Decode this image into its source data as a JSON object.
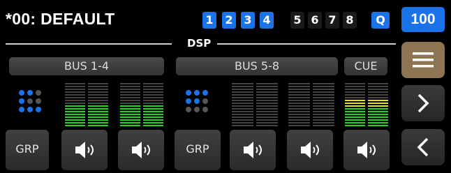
{
  "header": {
    "title": "*00: DEFAULT",
    "section_label": "DSP",
    "volume": "100"
  },
  "bus_tabs": [
    {
      "label": "1",
      "active": true
    },
    {
      "label": "2",
      "active": true
    },
    {
      "label": "3",
      "active": true
    },
    {
      "label": "4",
      "active": true
    },
    {
      "label": "5",
      "active": false
    },
    {
      "label": "6",
      "active": false
    },
    {
      "label": "7",
      "active": false
    },
    {
      "label": "8",
      "active": false
    }
  ],
  "q_button": "Q",
  "groups": [
    {
      "label": "BUS 1-4"
    },
    {
      "label": "BUS 5-8"
    },
    {
      "label": "CUE"
    }
  ],
  "bottom_buttons": [
    {
      "label": "GRP",
      "kind": "grp"
    },
    {
      "label": "",
      "kind": "speaker"
    },
    {
      "label": "",
      "kind": "speaker"
    },
    {
      "label": "GRP",
      "kind": "grp"
    },
    {
      "label": "",
      "kind": "speaker"
    },
    {
      "label": "",
      "kind": "speaker"
    },
    {
      "label": "",
      "kind": "speaker"
    }
  ],
  "meters": [
    {
      "name": "bus-1-4-meter-a",
      "level": 0.5,
      "color": "#1fd61f"
    },
    {
      "name": "bus-1-4-meter-b",
      "level": 0.5,
      "color": "#1fd61f"
    },
    {
      "name": "bus-5-8-meter-a",
      "level": 0.0,
      "color": "#1fd61f"
    },
    {
      "name": "bus-5-8-meter-b",
      "level": 0.0,
      "color": "#1fd61f"
    },
    {
      "name": "cue-meter",
      "level": 0.6,
      "color": "#1fd61f"
    }
  ],
  "colors": {
    "accent": "#1a73e8",
    "menu": "#8c7550",
    "meter_green": "#1fd61f",
    "meter_yellow": "#e6e600",
    "meter_off": "#444444"
  },
  "sidebar": {
    "icons": [
      "menu-icon",
      "chevron-right-icon",
      "chevron-left-icon"
    ]
  }
}
